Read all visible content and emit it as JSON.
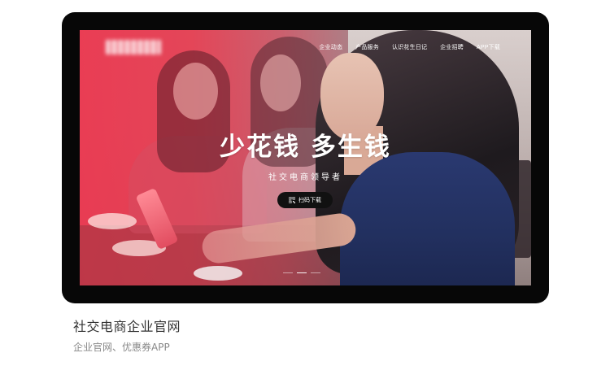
{
  "nav": {
    "items": [
      "企业动态",
      "产品服务",
      "认识花生日记",
      "企业招聘",
      "APP下载"
    ]
  },
  "hero": {
    "title": "少花钱 多生钱",
    "subtitle": "社交电商领导者",
    "button_label": "扫码下载",
    "button_icon": "qr-code-icon",
    "slide_count": 3,
    "active_slide": 2
  },
  "caption": {
    "title": "社交电商企业官网",
    "subtitle": "企业官网、优惠券APP"
  },
  "colors": {
    "accent": "#ec3a52",
    "device_frame": "#070707",
    "button_bg": "#111111"
  }
}
